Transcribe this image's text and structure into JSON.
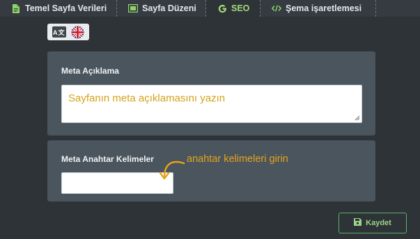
{
  "tabs": [
    {
      "label": "Temel Sayfa Verileri",
      "icon": "file-icon"
    },
    {
      "label": "Sayfa Düzeni",
      "icon": "layout-icon"
    },
    {
      "label": "SEO",
      "icon": "google-icon",
      "active": true
    },
    {
      "label": "Şema işaretlemesi",
      "icon": "code-icon"
    }
  ],
  "languages": {
    "translate_label": "A文",
    "flag": "uk-flag-icon"
  },
  "meta_description": {
    "label": "Meta Açıklama",
    "placeholder": "Sayfanın meta açıklamasını yazın"
  },
  "meta_keywords": {
    "label": "Meta Anahtar Kelimeler",
    "value": "",
    "hint": "anahtar kelimeleri girin"
  },
  "save_button": {
    "label": "Kaydet",
    "icon": "save-icon"
  },
  "colors": {
    "background": "#2e3338",
    "panel": "#4a555e",
    "active_tab": "#a7d77a",
    "accent": "#e7a31a",
    "save_border": "#5fb16a"
  }
}
